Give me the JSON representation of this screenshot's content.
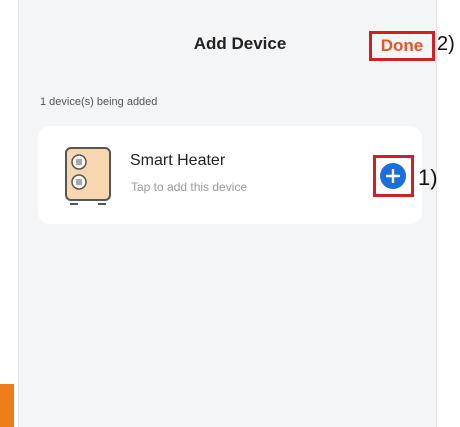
{
  "header": {
    "title": "Add Device",
    "done_label": "Done"
  },
  "callouts": {
    "done": "2)",
    "add": "1)"
  },
  "section": {
    "caption": "1 device(s) being added"
  },
  "device": {
    "name": "Smart Heater",
    "subtitle": "Tap to add this device",
    "icon": "heater-icon"
  },
  "colors": {
    "accent_done": "#e8532a",
    "highlight_border": "#d01f26",
    "add_button": "#1c6fd8",
    "heater_body": "#f7d7b0"
  }
}
